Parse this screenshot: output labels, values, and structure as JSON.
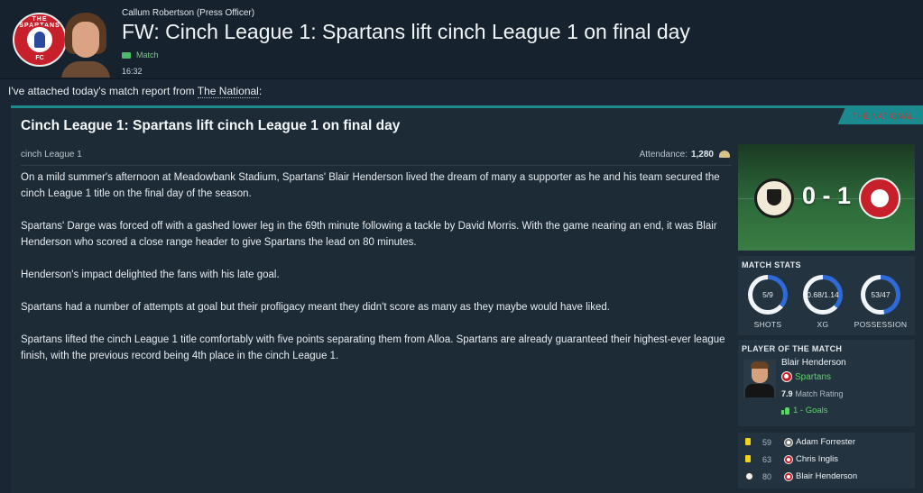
{
  "header": {
    "sender": "Callum Robertson  (Press Officer)",
    "subject": "FW: Cinch League 1: Spartans lift cinch League 1 on final day",
    "tag": "Match",
    "time": "16:32",
    "badge_top_text": "THE SPARTANS",
    "badge_bottom_text": "FC"
  },
  "intro": {
    "prefix": "I've attached today's match report from ",
    "source": "The National",
    "suffix": ":"
  },
  "report": {
    "paper_name": "THE NATIONAL",
    "title": "Cinch League 1: Spartans lift cinch League 1 on final day",
    "competition": "cinch League 1",
    "attendance_label": "Attendance:",
    "attendance_value": "1,280",
    "paragraphs": [
      "On a mild summer's afternoon at Meadowbank Stadium, Spartans' Blair Henderson lived the dream of many a supporter as he and his team secured the cinch League 1 title on the final day of the season.",
      "Spartans' Darge was forced off with a gashed lower leg in the 69th minute following a tackle by David Morris. With the game nearing an end, it was Blair Henderson who scored a close range header to give Spartans the lead on 80 minutes.",
      "Henderson's impact delighted the fans with his late goal.",
      "Spartans had a number of attempts at goal but their profligacy meant they didn't score as many as they maybe would have liked.",
      "Spartans lifted the cinch League 1 title comfortably with five points separating them from Alloa. Spartans are already guaranteed their highest-ever league finish, with the previous record being 4th place in the cinch League 1."
    ]
  },
  "scoreboard": {
    "score": "0 - 1"
  },
  "match_stats": {
    "title": "MATCH STATS",
    "items": [
      {
        "label": "SHOTS",
        "value": "5/9",
        "fraction": 0.36,
        "color": "#2f6ad9"
      },
      {
        "label": "XG",
        "value": "0.68/1.14",
        "fraction": 0.37,
        "color": "#2f6ad9"
      },
      {
        "label": "POSSESSION",
        "value": "53/47",
        "fraction": 0.47,
        "color": "#2f6ad9"
      }
    ]
  },
  "potm": {
    "title": "PLAYER OF THE MATCH",
    "name": "Blair Henderson",
    "club": "Spartans",
    "rating_value": "7.9",
    "rating_label": "Match Rating",
    "goals": "1 - Goals"
  },
  "events": [
    {
      "type": "yellow-card",
      "minute": "59",
      "player": "Adam Forrester",
      "team": "home"
    },
    {
      "type": "yellow-card",
      "minute": "63",
      "player": "Chris Inglis",
      "team": "away"
    },
    {
      "type": "goal",
      "minute": "80",
      "player": "Blair Henderson",
      "team": "away"
    }
  ],
  "colors": {
    "accent_teal": "#1a8a8f",
    "green": "#5fd36b",
    "ring_blue": "#2f6ad9",
    "spartans_red": "#c8202a"
  }
}
